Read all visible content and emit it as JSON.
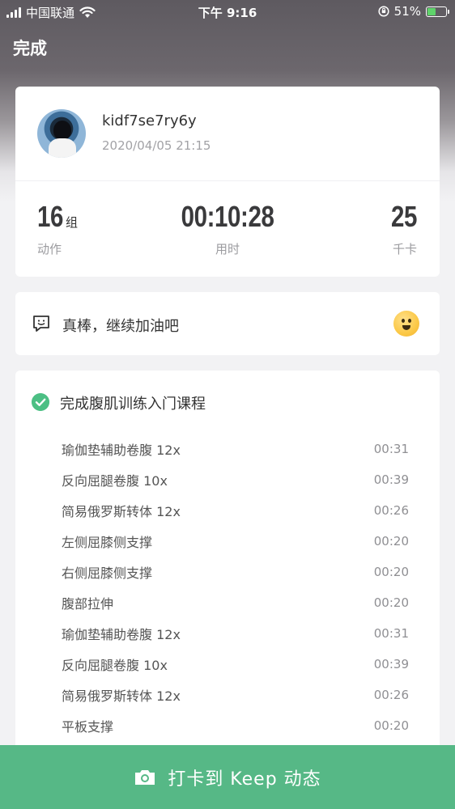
{
  "status_bar": {
    "carrier": "中国联通",
    "time": "下午 9:16",
    "battery_percent": "51%",
    "battery_level": 0.51
  },
  "nav": {
    "done_label": "完成"
  },
  "profile": {
    "username": "kidf7se7ry6y",
    "datetime": "2020/04/05 21:15"
  },
  "stats": {
    "groups": {
      "value": "16",
      "unit": "组",
      "label": "动作"
    },
    "duration": {
      "value": "00:10:28",
      "label": "用时"
    },
    "calories": {
      "value": "25",
      "label": "千卡"
    }
  },
  "cheer": {
    "text": "真棒，继续加油吧"
  },
  "course": {
    "title": "完成腹肌训练入门课程",
    "exercises": [
      {
        "name": "瑜伽垫辅助卷腹 12x",
        "duration": "00:31"
      },
      {
        "name": "反向屈腿卷腹 10x",
        "duration": "00:39"
      },
      {
        "name": "简易俄罗斯转体 12x",
        "duration": "00:26"
      },
      {
        "name": "左侧屈膝侧支撑",
        "duration": "00:20"
      },
      {
        "name": "右侧屈膝侧支撑",
        "duration": "00:20"
      },
      {
        "name": "腹部拉伸",
        "duration": "00:20"
      },
      {
        "name": "瑜伽垫辅助卷腹 12x",
        "duration": "00:31"
      },
      {
        "name": "反向屈腿卷腹 10x",
        "duration": "00:39"
      },
      {
        "name": "简易俄罗斯转体 12x",
        "duration": "00:26"
      },
      {
        "name": "平板支撑",
        "duration": "00:20"
      }
    ]
  },
  "bottom_action": {
    "label": "打卡到 Keep 动态"
  },
  "colors": {
    "accent_green": "#56b886",
    "check_green": "#4cbf84"
  },
  "icons": [
    "signal-icon",
    "wifi-icon",
    "orientation-lock-icon",
    "battery-icon",
    "chat-smile-icon",
    "smiley-emoji-icon",
    "check-circle-icon",
    "camera-icon"
  ]
}
